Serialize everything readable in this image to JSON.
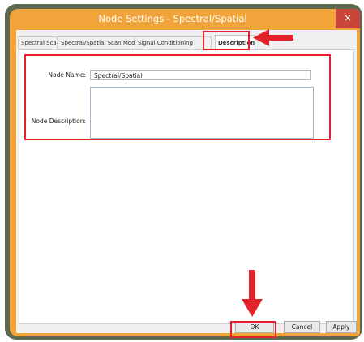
{
  "window": {
    "title": "Node Settings - Spectral/Spatial",
    "close_glyph": "×"
  },
  "tabs": [
    {
      "label": "Spectral Scan"
    },
    {
      "label": "Spectral/Spatial Scan Modes"
    },
    {
      "label": "Signal Conditioning"
    },
    {
      "label": "Description",
      "active": true
    }
  ],
  "form": {
    "node_name_label": "Node Name:",
    "node_name_value": "Spectral/Spatial",
    "node_description_label": "Node Description:",
    "node_description_value": ""
  },
  "buttons": {
    "ok": "OK",
    "cancel": "Cancel",
    "apply": "Apply"
  },
  "colors": {
    "title_bar": "#f0a43a",
    "highlight": "#e3222b"
  }
}
